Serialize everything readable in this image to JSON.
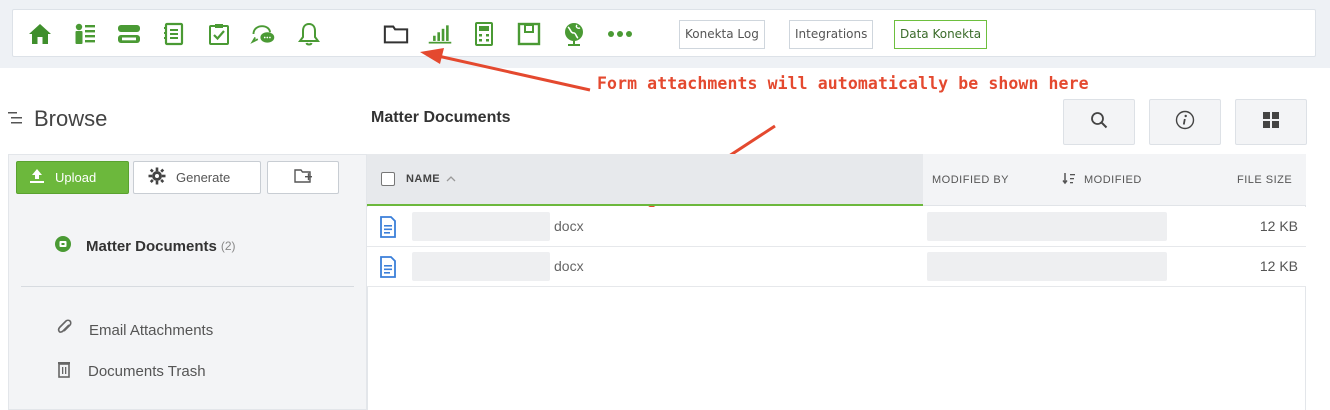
{
  "toolbar": {
    "icons": [
      "home-icon",
      "contacts-list-icon",
      "matters-stack-icon",
      "notes-icon",
      "tasks-check-icon",
      "communications-chat-icon",
      "notifications-bell-icon",
      "documents-folder-icon",
      "reports-bar-chart-icon",
      "calculator-icon",
      "forms-icon",
      "web-globe-icon",
      "more-dots-icon"
    ],
    "tabs": [
      "Konekta Log",
      "Integrations",
      "Data Konekta"
    ],
    "active_tab": "Data Konekta",
    "accent_color": "#6cb83c"
  },
  "annotation": {
    "text": "Form attachments will automatically be shown here",
    "color": "#e4492f"
  },
  "browse": {
    "title": "Browse",
    "upload_label": "Upload",
    "generate_label": "Generate",
    "tree": {
      "root_label": "Matter Documents",
      "root_count": "(2)",
      "items": [
        "Email Attachments",
        "Documents Trash"
      ]
    }
  },
  "main": {
    "title": "Matter Documents",
    "columns": {
      "name": "NAME",
      "modified_by": "MODIFIED BY",
      "modified": "MODIFIED",
      "file_size": "FILE SIZE"
    },
    "rows": [
      {
        "ext": "docx",
        "size": "12 KB"
      },
      {
        "ext": "docx",
        "size": "12 KB"
      }
    ]
  }
}
